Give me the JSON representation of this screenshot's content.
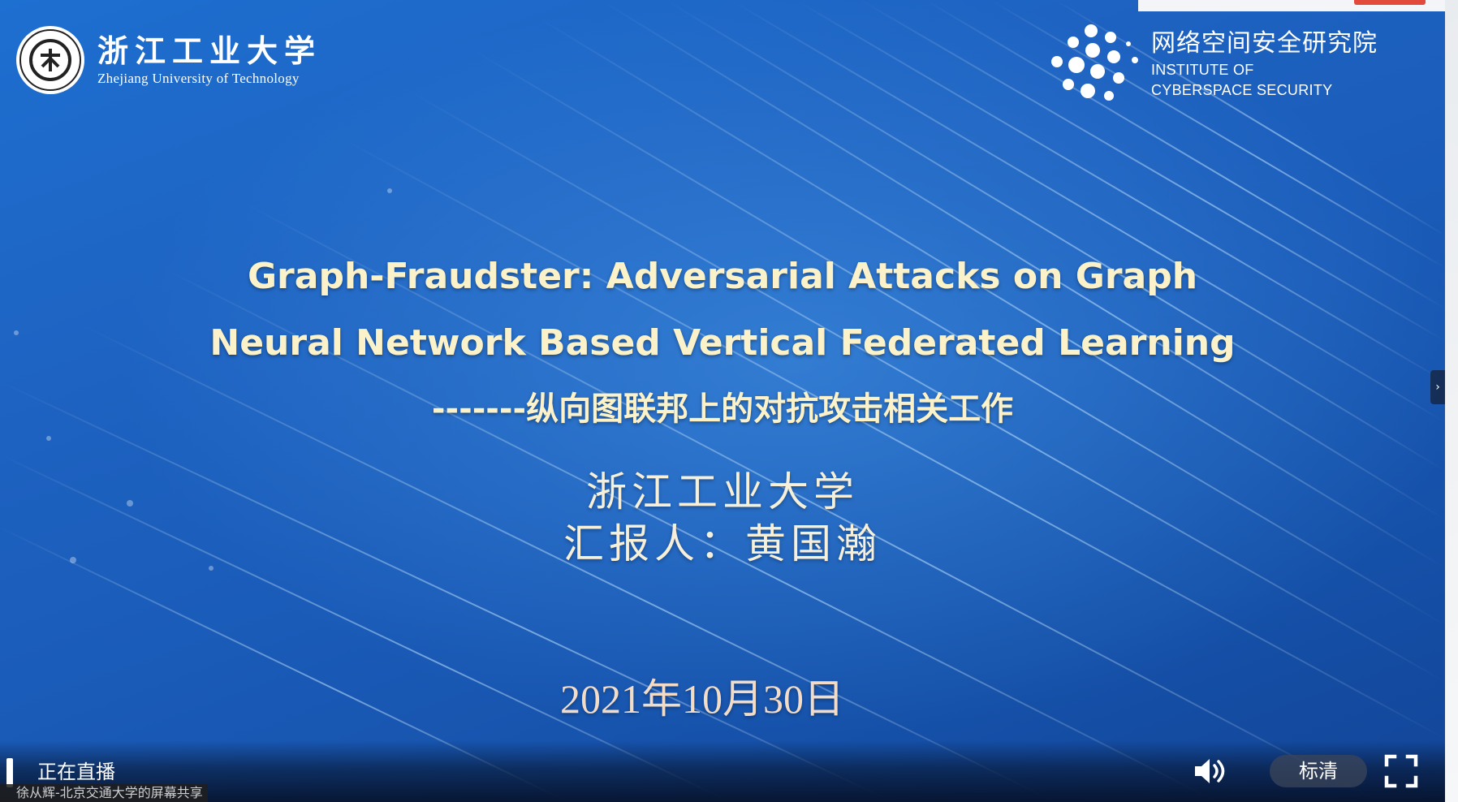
{
  "slide": {
    "university": {
      "name_cn": "浙江工业大学",
      "name_en": "Zhejiang University of Technology"
    },
    "institute": {
      "name_cn": "网络空间安全研究院",
      "name_en_line1": "INSTITUTE OF",
      "name_en_line2": "CYBERSPACE SECURITY"
    },
    "title_line1": "Graph-Fraudster: Adversarial Attacks on Graph",
    "title_line2": "Neural Network Based Vertical Federated Learning",
    "subtitle": "-------纵向图联邦上的对抗攻击相关工作",
    "organization": "浙江工业大学",
    "reporter": "汇报人：黄国瀚",
    "date": "2021年10月30日"
  },
  "player": {
    "live_label": "正在直播",
    "share_caption": "徐从辉-北京交通大学的屏幕共享",
    "quality_label": "标清",
    "volume_icon": "speaker-icon",
    "fullscreen_icon": "fullscreen-icon",
    "side_handle_icon": "chevron-right-icon"
  },
  "colors": {
    "slide_blue": "#1e63c2",
    "title_text": "#fbf2c9",
    "date_text": "#f2dcc8",
    "top_strip_button": "#e24a3b"
  }
}
